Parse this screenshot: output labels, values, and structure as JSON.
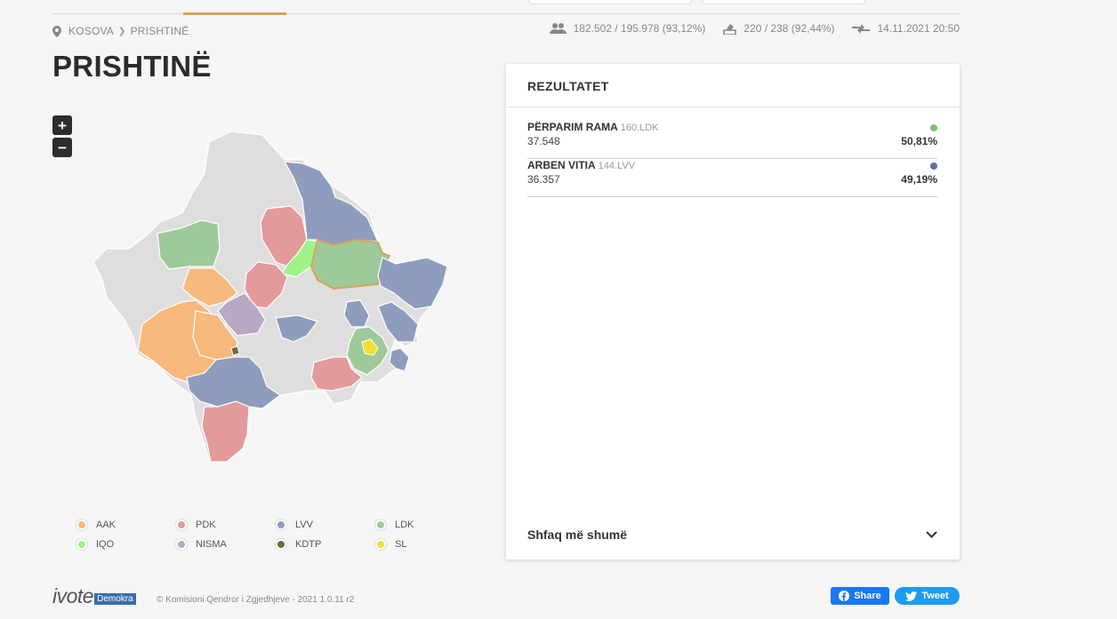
{
  "breadcrumb": {
    "country": "KOSOVA",
    "municipality": "PRISHTINË"
  },
  "stats": {
    "voters": "182.502 / 195.978 (93,12%)",
    "stations": "220 / 238 (92,44%)",
    "updated": "14.11.2021 20:50"
  },
  "page": {
    "title": "PRISHTINË"
  },
  "zoom": {
    "in": "+",
    "out": "−"
  },
  "colors": {
    "AAK": "#f7b97c",
    "PDK": "#e39a9a",
    "LVV": "#8e9dbd",
    "LDK": "#9ec99a",
    "IQO": "#9ef28a",
    "NISMA": "#b7a8c4",
    "KDTP": "#6d6a40",
    "SL": "#f2df34",
    "none": "#dedede",
    "highlight": "#d3a45b"
  },
  "legend": [
    {
      "label": "AAK",
      "color": "#f7b97c"
    },
    {
      "label": "PDK",
      "color": "#e39a9a"
    },
    {
      "label": "LVV",
      "color": "#8e9dbd"
    },
    {
      "label": "LDK",
      "color": "#9ec99a"
    },
    {
      "label": "IQO",
      "color": "#9ef28a"
    },
    {
      "label": "NISMA",
      "color": "#b7a8c4"
    },
    {
      "label": "KDTP",
      "color": "#6d6a40"
    },
    {
      "label": "SL",
      "color": "#f2df34"
    }
  ],
  "results": {
    "title": "REZULTATET",
    "candidates": [
      {
        "name": "PËRPARIM RAMA",
        "party": "160.LDK",
        "votes": "37.548",
        "percent": "50,81%",
        "color": "#7cbf6e"
      },
      {
        "name": "ARBEN VITIA",
        "party": "144.LVV",
        "votes": "36.357",
        "percent": "49,19%",
        "color": "#5b6f9c"
      }
    ],
    "show_more": "Shfaq më shumë"
  },
  "footer": {
    "logo": "ivote",
    "logo_badge": "Demokra",
    "copyright": "© Komisioni Qendror i Zgjedhjeve - 2021 1.0.11 r2",
    "share": "Share",
    "tweet": "Tweet"
  }
}
